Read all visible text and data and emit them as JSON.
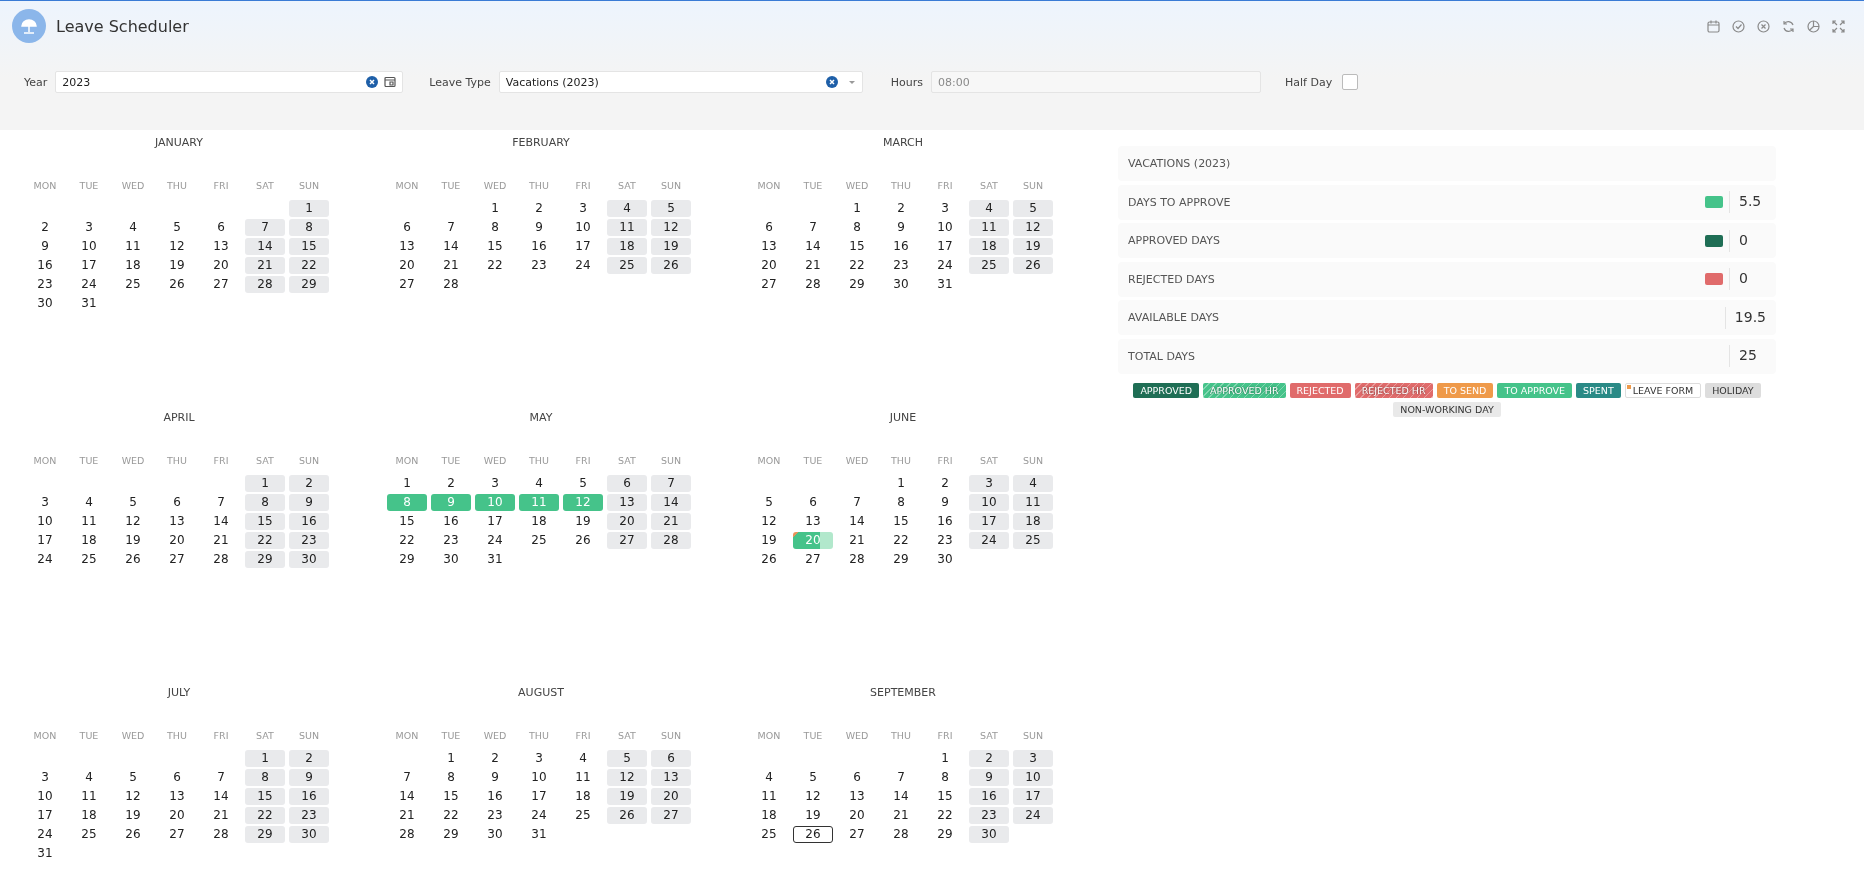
{
  "app": {
    "title": "Leave Scheduler"
  },
  "filters": {
    "year": {
      "label": "Year",
      "value": "2023"
    },
    "leave_type": {
      "label": "Leave Type",
      "value": "Vacations (2023)"
    },
    "hours": {
      "label": "Hours",
      "value": "08:00",
      "disabled": true
    },
    "half_day": {
      "label": "Half Day",
      "checked": false
    }
  },
  "calendar": {
    "months": [
      {
        "name": "JANUARY",
        "weekdays": [
          "MON",
          "TUE",
          "WED",
          "THU",
          "FRI",
          "SAT",
          "SUN"
        ],
        "weeks": [
          [
            {
              "d": "1",
              "kind": "weekend"
            }
          ],
          [
            {
              "d": "2",
              "kind": "workday"
            },
            {
              "d": "3",
              "kind": "workday"
            },
            {
              "d": "4",
              "kind": "workday"
            },
            {
              "d": "5",
              "kind": "workday"
            },
            {
              "d": "6",
              "kind": "workday"
            },
            {
              "d": "7",
              "kind": "weekend"
            },
            {
              "d": "8",
              "kind": "weekend"
            }
          ],
          [
            {
              "d": "9",
              "kind": "workday"
            },
            {
              "d": "10",
              "kind": "workday"
            },
            {
              "d": "11",
              "kind": "workday"
            },
            {
              "d": "12",
              "kind": "workday"
            },
            {
              "d": "13",
              "kind": "workday"
            },
            {
              "d": "14",
              "kind": "weekend"
            },
            {
              "d": "15",
              "kind": "weekend"
            }
          ],
          [
            {
              "d": "16",
              "kind": "workday"
            },
            {
              "d": "17",
              "kind": "workday"
            },
            {
              "d": "18",
              "kind": "workday"
            },
            {
              "d": "19",
              "kind": "workday"
            },
            {
              "d": "20",
              "kind": "workday"
            },
            {
              "d": "21",
              "kind": "weekend"
            },
            {
              "d": "22",
              "kind": "weekend"
            }
          ],
          [
            {
              "d": "23",
              "kind": "workday"
            },
            {
              "d": "24",
              "kind": "workday"
            },
            {
              "d": "25",
              "kind": "workday"
            },
            {
              "d": "26",
              "kind": "workday"
            },
            {
              "d": "27",
              "kind": "workday"
            },
            {
              "d": "28",
              "kind": "weekend"
            },
            {
              "d": "29",
              "kind": "weekend"
            }
          ],
          [
            {
              "d": "30",
              "kind": "workday"
            },
            {
              "d": "31",
              "kind": "workday"
            }
          ]
        ]
      },
      {
        "name": "FEBRUARY",
        "weekdays": [
          "MON",
          "TUE",
          "WED",
          "THU",
          "FRI",
          "SAT",
          "SUN"
        ],
        "weeks": [
          [
            {
              "d": "1",
              "kind": "workday"
            },
            {
              "d": "2",
              "kind": "workday"
            },
            {
              "d": "3",
              "kind": "workday"
            },
            {
              "d": "4",
              "kind": "weekend"
            },
            {
              "d": "5",
              "kind": "weekend"
            }
          ],
          [
            {
              "d": "6",
              "kind": "workday"
            },
            {
              "d": "7",
              "kind": "workday"
            },
            {
              "d": "8",
              "kind": "workday"
            },
            {
              "d": "9",
              "kind": "workday"
            },
            {
              "d": "10",
              "kind": "workday"
            },
            {
              "d": "11",
              "kind": "weekend"
            },
            {
              "d": "12",
              "kind": "weekend"
            }
          ],
          [
            {
              "d": "13",
              "kind": "workday"
            },
            {
              "d": "14",
              "kind": "workday"
            },
            {
              "d": "15",
              "kind": "workday"
            },
            {
              "d": "16",
              "kind": "workday"
            },
            {
              "d": "17",
              "kind": "workday"
            },
            {
              "d": "18",
              "kind": "weekend"
            },
            {
              "d": "19",
              "kind": "weekend"
            }
          ],
          [
            {
              "d": "20",
              "kind": "workday"
            },
            {
              "d": "21",
              "kind": "workday"
            },
            {
              "d": "22",
              "kind": "workday"
            },
            {
              "d": "23",
              "kind": "workday"
            },
            {
              "d": "24",
              "kind": "workday"
            },
            {
              "d": "25",
              "kind": "weekend"
            },
            {
              "d": "26",
              "kind": "weekend"
            }
          ],
          [
            {
              "d": "27",
              "kind": "workday"
            },
            {
              "d": "28",
              "kind": "workday"
            }
          ]
        ]
      },
      {
        "name": "MARCH",
        "weekdays": [
          "MON",
          "TUE",
          "WED",
          "THU",
          "FRI",
          "SAT",
          "SUN"
        ],
        "weeks": [
          [
            {
              "d": "1",
              "kind": "workday"
            },
            {
              "d": "2",
              "kind": "workday"
            },
            {
              "d": "3",
              "kind": "workday"
            },
            {
              "d": "4",
              "kind": "weekend"
            },
            {
              "d": "5",
              "kind": "weekend"
            }
          ],
          [
            {
              "d": "6",
              "kind": "workday"
            },
            {
              "d": "7",
              "kind": "workday"
            },
            {
              "d": "8",
              "kind": "workday"
            },
            {
              "d": "9",
              "kind": "workday"
            },
            {
              "d": "10",
              "kind": "workday"
            },
            {
              "d": "11",
              "kind": "weekend"
            },
            {
              "d": "12",
              "kind": "weekend"
            }
          ],
          [
            {
              "d": "13",
              "kind": "workday"
            },
            {
              "d": "14",
              "kind": "workday"
            },
            {
              "d": "15",
              "kind": "workday"
            },
            {
              "d": "16",
              "kind": "workday"
            },
            {
              "d": "17",
              "kind": "workday"
            },
            {
              "d": "18",
              "kind": "weekend"
            },
            {
              "d": "19",
              "kind": "weekend"
            }
          ],
          [
            {
              "d": "20",
              "kind": "workday"
            },
            {
              "d": "21",
              "kind": "workday"
            },
            {
              "d": "22",
              "kind": "workday"
            },
            {
              "d": "23",
              "kind": "workday"
            },
            {
              "d": "24",
              "kind": "workday"
            },
            {
              "d": "25",
              "kind": "weekend"
            },
            {
              "d": "26",
              "kind": "weekend"
            }
          ],
          [
            {
              "d": "27",
              "kind": "workday"
            },
            {
              "d": "28",
              "kind": "workday"
            },
            {
              "d": "29",
              "kind": "workday"
            },
            {
              "d": "30",
              "kind": "workday"
            },
            {
              "d": "31",
              "kind": "workday"
            }
          ]
        ]
      },
      {
        "name": "APRIL",
        "weekdays": [
          "MON",
          "TUE",
          "WED",
          "THU",
          "FRI",
          "SAT",
          "SUN"
        ],
        "weeks": [
          [
            {
              "d": "1",
              "kind": "weekend"
            },
            {
              "d": "2",
              "kind": "weekend"
            }
          ],
          [
            {
              "d": "3",
              "kind": "workday"
            },
            {
              "d": "4",
              "kind": "workday"
            },
            {
              "d": "5",
              "kind": "workday"
            },
            {
              "d": "6",
              "kind": "workday"
            },
            {
              "d": "7",
              "kind": "workday"
            },
            {
              "d": "8",
              "kind": "weekend"
            },
            {
              "d": "9",
              "kind": "weekend"
            }
          ],
          [
            {
              "d": "10",
              "kind": "workday"
            },
            {
              "d": "11",
              "kind": "workday"
            },
            {
              "d": "12",
              "kind": "workday"
            },
            {
              "d": "13",
              "kind": "workday"
            },
            {
              "d": "14",
              "kind": "workday"
            },
            {
              "d": "15",
              "kind": "weekend"
            },
            {
              "d": "16",
              "kind": "weekend"
            }
          ],
          [
            {
              "d": "17",
              "kind": "workday"
            },
            {
              "d": "18",
              "kind": "workday"
            },
            {
              "d": "19",
              "kind": "workday"
            },
            {
              "d": "20",
              "kind": "workday"
            },
            {
              "d": "21",
              "kind": "workday"
            },
            {
              "d": "22",
              "kind": "weekend"
            },
            {
              "d": "23",
              "kind": "weekend"
            }
          ],
          [
            {
              "d": "24",
              "kind": "workday"
            },
            {
              "d": "25",
              "kind": "workday"
            },
            {
              "d": "26",
              "kind": "workday"
            },
            {
              "d": "27",
              "kind": "workday"
            },
            {
              "d": "28",
              "kind": "workday"
            },
            {
              "d": "29",
              "kind": "weekend"
            },
            {
              "d": "30",
              "kind": "weekend"
            }
          ]
        ]
      },
      {
        "name": "MAY",
        "weekdays": [
          "MON",
          "TUE",
          "WED",
          "THU",
          "FRI",
          "SAT",
          "SUN"
        ],
        "weeks": [
          [
            {
              "d": "1",
              "kind": "workday"
            },
            {
              "d": "2",
              "kind": "workday"
            },
            {
              "d": "3",
              "kind": "workday"
            },
            {
              "d": "4",
              "kind": "workday"
            },
            {
              "d": "5",
              "kind": "workday"
            },
            {
              "d": "6",
              "kind": "weekend"
            },
            {
              "d": "7",
              "kind": "weekend"
            }
          ],
          [
            {
              "d": "8",
              "kind": "to_approve"
            },
            {
              "d": "9",
              "kind": "to_approve"
            },
            {
              "d": "10",
              "kind": "to_approve"
            },
            {
              "d": "11",
              "kind": "to_approve"
            },
            {
              "d": "12",
              "kind": "to_approve"
            },
            {
              "d": "13",
              "kind": "weekend"
            },
            {
              "d": "14",
              "kind": "weekend"
            }
          ],
          [
            {
              "d": "15",
              "kind": "workday"
            },
            {
              "d": "16",
              "kind": "workday"
            },
            {
              "d": "17",
              "kind": "workday"
            },
            {
              "d": "18",
              "kind": "workday"
            },
            {
              "d": "19",
              "kind": "workday"
            },
            {
              "d": "20",
              "kind": "weekend"
            },
            {
              "d": "21",
              "kind": "weekend"
            }
          ],
          [
            {
              "d": "22",
              "kind": "workday"
            },
            {
              "d": "23",
              "kind": "workday"
            },
            {
              "d": "24",
              "kind": "workday"
            },
            {
              "d": "25",
              "kind": "workday"
            },
            {
              "d": "26",
              "kind": "workday"
            },
            {
              "d": "27",
              "kind": "weekend"
            },
            {
              "d": "28",
              "kind": "weekend"
            }
          ],
          [
            {
              "d": "29",
              "kind": "workday"
            },
            {
              "d": "30",
              "kind": "workday"
            },
            {
              "d": "31",
              "kind": "workday"
            }
          ]
        ]
      },
      {
        "name": "JUNE",
        "weekdays": [
          "MON",
          "TUE",
          "WED",
          "THU",
          "FRI",
          "SAT",
          "SUN"
        ],
        "weeks": [
          [
            {
              "d": "1",
              "kind": "workday"
            },
            {
              "d": "2",
              "kind": "workday"
            },
            {
              "d": "3",
              "kind": "weekend"
            },
            {
              "d": "4",
              "kind": "weekend"
            }
          ],
          [
            {
              "d": "5",
              "kind": "workday"
            },
            {
              "d": "6",
              "kind": "workday"
            },
            {
              "d": "7",
              "kind": "workday"
            },
            {
              "d": "8",
              "kind": "workday"
            },
            {
              "d": "9",
              "kind": "workday"
            },
            {
              "d": "10",
              "kind": "weekend"
            },
            {
              "d": "11",
              "kind": "weekend"
            }
          ],
          [
            {
              "d": "12",
              "kind": "workday"
            },
            {
              "d": "13",
              "kind": "workday"
            },
            {
              "d": "14",
              "kind": "workday"
            },
            {
              "d": "15",
              "kind": "workday"
            },
            {
              "d": "16",
              "kind": "workday"
            },
            {
              "d": "17",
              "kind": "weekend"
            },
            {
              "d": "18",
              "kind": "weekend"
            }
          ],
          [
            {
              "d": "19",
              "kind": "workday"
            },
            {
              "d": "20",
              "kind": "partial"
            },
            {
              "d": "21",
              "kind": "workday"
            },
            {
              "d": "22",
              "kind": "workday"
            },
            {
              "d": "23",
              "kind": "workday"
            },
            {
              "d": "24",
              "kind": "weekend"
            },
            {
              "d": "25",
              "kind": "weekend"
            }
          ],
          [
            {
              "d": "26",
              "kind": "workday"
            },
            {
              "d": "27",
              "kind": "workday"
            },
            {
              "d": "28",
              "kind": "workday"
            },
            {
              "d": "29",
              "kind": "workday"
            },
            {
              "d": "30",
              "kind": "workday"
            }
          ]
        ]
      },
      {
        "name": "JULY",
        "weekdays": [
          "MON",
          "TUE",
          "WED",
          "THU",
          "FRI",
          "SAT",
          "SUN"
        ],
        "weeks": [
          [
            {
              "d": "1",
              "kind": "weekend"
            },
            {
              "d": "2",
              "kind": "weekend"
            }
          ],
          [
            {
              "d": "3",
              "kind": "workday"
            },
            {
              "d": "4",
              "kind": "workday"
            },
            {
              "d": "5",
              "kind": "workday"
            },
            {
              "d": "6",
              "kind": "workday"
            },
            {
              "d": "7",
              "kind": "workday"
            },
            {
              "d": "8",
              "kind": "weekend"
            },
            {
              "d": "9",
              "kind": "weekend"
            }
          ],
          [
            {
              "d": "10",
              "kind": "workday"
            },
            {
              "d": "11",
              "kind": "workday"
            },
            {
              "d": "12",
              "kind": "workday"
            },
            {
              "d": "13",
              "kind": "workday"
            },
            {
              "d": "14",
              "kind": "workday"
            },
            {
              "d": "15",
              "kind": "weekend"
            },
            {
              "d": "16",
              "kind": "weekend"
            }
          ],
          [
            {
              "d": "17",
              "kind": "workday"
            },
            {
              "d": "18",
              "kind": "workday"
            },
            {
              "d": "19",
              "kind": "workday"
            },
            {
              "d": "20",
              "kind": "workday"
            },
            {
              "d": "21",
              "kind": "workday"
            },
            {
              "d": "22",
              "kind": "weekend"
            },
            {
              "d": "23",
              "kind": "weekend"
            }
          ],
          [
            {
              "d": "24",
              "kind": "workday"
            },
            {
              "d": "25",
              "kind": "workday"
            },
            {
              "d": "26",
              "kind": "workday"
            },
            {
              "d": "27",
              "kind": "workday"
            },
            {
              "d": "28",
              "kind": "workday"
            },
            {
              "d": "29",
              "kind": "weekend"
            },
            {
              "d": "30",
              "kind": "weekend"
            }
          ],
          [
            {
              "d": "31",
              "kind": "workday"
            }
          ]
        ]
      },
      {
        "name": "AUGUST",
        "weekdays": [
          "MON",
          "TUE",
          "WED",
          "THU",
          "FRI",
          "SAT",
          "SUN"
        ],
        "weeks": [
          [
            {
              "d": "1",
              "kind": "workday"
            },
            {
              "d": "2",
              "kind": "workday"
            },
            {
              "d": "3",
              "kind": "workday"
            },
            {
              "d": "4",
              "kind": "workday"
            },
            {
              "d": "5",
              "kind": "weekend"
            },
            {
              "d": "6",
              "kind": "weekend"
            }
          ],
          [
            {
              "d": "7",
              "kind": "workday"
            },
            {
              "d": "8",
              "kind": "workday"
            },
            {
              "d": "9",
              "kind": "workday"
            },
            {
              "d": "10",
              "kind": "workday"
            },
            {
              "d": "11",
              "kind": "workday"
            },
            {
              "d": "12",
              "kind": "weekend"
            },
            {
              "d": "13",
              "kind": "weekend"
            }
          ],
          [
            {
              "d": "14",
              "kind": "workday"
            },
            {
              "d": "15",
              "kind": "workday"
            },
            {
              "d": "16",
              "kind": "workday"
            },
            {
              "d": "17",
              "kind": "workday"
            },
            {
              "d": "18",
              "kind": "workday"
            },
            {
              "d": "19",
              "kind": "weekend"
            },
            {
              "d": "20",
              "kind": "weekend"
            }
          ],
          [
            {
              "d": "21",
              "kind": "workday"
            },
            {
              "d": "22",
              "kind": "workday"
            },
            {
              "d": "23",
              "kind": "workday"
            },
            {
              "d": "24",
              "kind": "workday"
            },
            {
              "d": "25",
              "kind": "workday"
            },
            {
              "d": "26",
              "kind": "weekend"
            },
            {
              "d": "27",
              "kind": "weekend"
            }
          ],
          [
            {
              "d": "28",
              "kind": "workday"
            },
            {
              "d": "29",
              "kind": "workday"
            },
            {
              "d": "30",
              "kind": "workday"
            },
            {
              "d": "31",
              "kind": "workday"
            }
          ]
        ]
      },
      {
        "name": "SEPTEMBER",
        "weekdays": [
          "MON",
          "TUE",
          "WED",
          "THU",
          "FRI",
          "SAT",
          "SUN"
        ],
        "weeks": [
          [
            {
              "d": "1",
              "kind": "workday"
            },
            {
              "d": "2",
              "kind": "weekend"
            },
            {
              "d": "3",
              "kind": "weekend"
            }
          ],
          [
            {
              "d": "4",
              "kind": "workday"
            },
            {
              "d": "5",
              "kind": "workday"
            },
            {
              "d": "6",
              "kind": "workday"
            },
            {
              "d": "7",
              "kind": "workday"
            },
            {
              "d": "8",
              "kind": "workday"
            },
            {
              "d": "9",
              "kind": "weekend"
            },
            {
              "d": "10",
              "kind": "weekend"
            }
          ],
          [
            {
              "d": "11",
              "kind": "workday"
            },
            {
              "d": "12",
              "kind": "workday"
            },
            {
              "d": "13",
              "kind": "workday"
            },
            {
              "d": "14",
              "kind": "workday"
            },
            {
              "d": "15",
              "kind": "workday"
            },
            {
              "d": "16",
              "kind": "weekend"
            },
            {
              "d": "17",
              "kind": "weekend"
            }
          ],
          [
            {
              "d": "18",
              "kind": "workday"
            },
            {
              "d": "19",
              "kind": "workday"
            },
            {
              "d": "20",
              "kind": "workday"
            },
            {
              "d": "21",
              "kind": "workday"
            },
            {
              "d": "22",
              "kind": "workday"
            },
            {
              "d": "23",
              "kind": "weekend"
            },
            {
              "d": "24",
              "kind": "weekend"
            }
          ],
          [
            {
              "d": "25",
              "kind": "workday"
            },
            {
              "d": "26",
              "kind": "today"
            },
            {
              "d": "27",
              "kind": "workday"
            },
            {
              "d": "28",
              "kind": "workday"
            },
            {
              "d": "29",
              "kind": "workday"
            },
            {
              "d": "30",
              "kind": "weekend"
            }
          ]
        ]
      }
    ]
  },
  "summary": {
    "title": "VACATIONS (2023)",
    "rows": [
      {
        "label": "DAYS TO APPROVE",
        "value": "5.5",
        "color": "#45c38a"
      },
      {
        "label": "APPROVED DAYS",
        "value": "0",
        "color": "#1f6e55"
      },
      {
        "label": "REJECTED DAYS",
        "value": "0",
        "color": "#e06b6b"
      },
      {
        "label": "AVAILABLE DAYS",
        "value": "19.5"
      },
      {
        "label": "TOTAL DAYS",
        "value": "25"
      }
    ]
  },
  "legend": [
    {
      "label": "APPROVED",
      "kind": "solid",
      "color": "#1f6e55"
    },
    {
      "label": "APPROVED HR",
      "kind": "striped",
      "color": "#45c38a"
    },
    {
      "label": "REJECTED",
      "kind": "solid",
      "color": "#e06b6b"
    },
    {
      "label": "REJECTED HR",
      "kind": "striped",
      "color": "#e06b6b"
    },
    {
      "label": "TO SEND",
      "kind": "solid",
      "color": "#ef9a4a"
    },
    {
      "label": "TO APPROVE",
      "kind": "solid",
      "color": "#45c38a"
    },
    {
      "label": "SPENT",
      "kind": "solid",
      "color": "#2a8a86"
    },
    {
      "label": "LEAVE FORM",
      "kind": "form",
      "color": "#ef9a4a"
    },
    {
      "label": "HOLIDAY",
      "kind": "muted",
      "color": "#dddddd"
    },
    {
      "label": "NON-WORKING DAY",
      "kind": "muted",
      "color": "#e9e9e9"
    }
  ]
}
